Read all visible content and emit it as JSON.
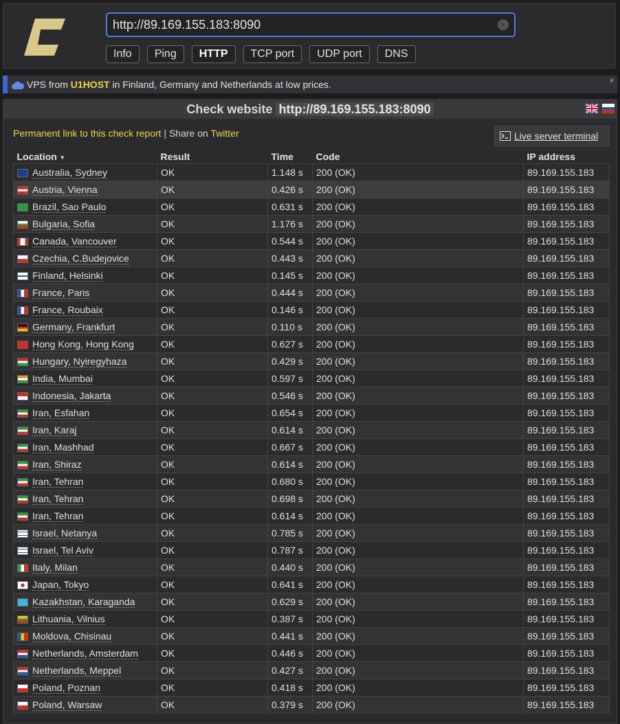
{
  "url_input": "http://89.169.155.183:8090",
  "tabs": [
    "Info",
    "Ping",
    "HTTP",
    "TCP port",
    "UDP port",
    "DNS"
  ],
  "active_tab": "HTTP",
  "banner": {
    "prefix": "VPS from ",
    "brand": "U1HOST",
    "suffix": " in Finland, Germany and Netherlands at low prices."
  },
  "panel": {
    "title_prefix": "Check website",
    "title_url": "http://89.169.155.183:8090",
    "permalink": "Permanent link to this check report",
    "share_sep": " | Share on ",
    "twitter": "Twitter",
    "terminal": "Live server terminal"
  },
  "table": {
    "headers": [
      "Location",
      "Result",
      "Time",
      "Code",
      "IP address"
    ],
    "rows": [
      {
        "flag": "au",
        "location": "Australia, Sydney",
        "result": "OK",
        "time": "1.148 s",
        "code": "200 (OK)",
        "ip": "89.169.155.183"
      },
      {
        "flag": "at",
        "location": "Austria, Vienna",
        "result": "OK",
        "time": "0.426 s",
        "code": "200 (OK)",
        "ip": "89.169.155.183"
      },
      {
        "flag": "br",
        "location": "Brazil, Sao Paulo",
        "result": "OK",
        "time": "0.631 s",
        "code": "200 (OK)",
        "ip": "89.169.155.183"
      },
      {
        "flag": "bg",
        "location": "Bulgaria, Sofia",
        "result": "OK",
        "time": "1.176 s",
        "code": "200 (OK)",
        "ip": "89.169.155.183"
      },
      {
        "flag": "ca",
        "location": "Canada, Vancouver",
        "result": "OK",
        "time": "0.544 s",
        "code": "200 (OK)",
        "ip": "89.169.155.183"
      },
      {
        "flag": "cz",
        "location": "Czechia, C.Budejovice",
        "result": "OK",
        "time": "0.443 s",
        "code": "200 (OK)",
        "ip": "89.169.155.183"
      },
      {
        "flag": "fi",
        "location": "Finland, Helsinki",
        "result": "OK",
        "time": "0.145 s",
        "code": "200 (OK)",
        "ip": "89.169.155.183"
      },
      {
        "flag": "fr",
        "location": "France, Paris",
        "result": "OK",
        "time": "0.444 s",
        "code": "200 (OK)",
        "ip": "89.169.155.183"
      },
      {
        "flag": "fr",
        "location": "France, Roubaix",
        "result": "OK",
        "time": "0.146 s",
        "code": "200 (OK)",
        "ip": "89.169.155.183"
      },
      {
        "flag": "de",
        "location": "Germany, Frankfurt",
        "result": "OK",
        "time": "0.110 s",
        "code": "200 (OK)",
        "ip": "89.169.155.183"
      },
      {
        "flag": "hk",
        "location": "Hong Kong, Hong Kong",
        "result": "OK",
        "time": "0.627 s",
        "code": "200 (OK)",
        "ip": "89.169.155.183"
      },
      {
        "flag": "hu",
        "location": "Hungary, Nyiregyhaza",
        "result": "OK",
        "time": "0.429 s",
        "code": "200 (OK)",
        "ip": "89.169.155.183"
      },
      {
        "flag": "in",
        "location": "India, Mumbai",
        "result": "OK",
        "time": "0.597 s",
        "code": "200 (OK)",
        "ip": "89.169.155.183"
      },
      {
        "flag": "id",
        "location": "Indonesia, Jakarta",
        "result": "OK",
        "time": "0.546 s",
        "code": "200 (OK)",
        "ip": "89.169.155.183"
      },
      {
        "flag": "ir",
        "location": "Iran, Esfahan",
        "result": "OK",
        "time": "0.654 s",
        "code": "200 (OK)",
        "ip": "89.169.155.183"
      },
      {
        "flag": "ir",
        "location": "Iran, Karaj",
        "result": "OK",
        "time": "0.614 s",
        "code": "200 (OK)",
        "ip": "89.169.155.183"
      },
      {
        "flag": "ir",
        "location": "Iran, Mashhad",
        "result": "OK",
        "time": "0.667 s",
        "code": "200 (OK)",
        "ip": "89.169.155.183"
      },
      {
        "flag": "ir",
        "location": "Iran, Shiraz",
        "result": "OK",
        "time": "0.614 s",
        "code": "200 (OK)",
        "ip": "89.169.155.183"
      },
      {
        "flag": "ir",
        "location": "Iran, Tehran",
        "result": "OK",
        "time": "0.680 s",
        "code": "200 (OK)",
        "ip": "89.169.155.183"
      },
      {
        "flag": "ir",
        "location": "Iran, Tehran",
        "result": "OK",
        "time": "0.698 s",
        "code": "200 (OK)",
        "ip": "89.169.155.183"
      },
      {
        "flag": "ir",
        "location": "Iran, Tehran",
        "result": "OK",
        "time": "0.614 s",
        "code": "200 (OK)",
        "ip": "89.169.155.183"
      },
      {
        "flag": "il",
        "location": "Israel, Netanya",
        "result": "OK",
        "time": "0.785 s",
        "code": "200 (OK)",
        "ip": "89.169.155.183"
      },
      {
        "flag": "il",
        "location": "Israel, Tel Aviv",
        "result": "OK",
        "time": "0.787 s",
        "code": "200 (OK)",
        "ip": "89.169.155.183"
      },
      {
        "flag": "it",
        "location": "Italy, Milan",
        "result": "OK",
        "time": "0.440 s",
        "code": "200 (OK)",
        "ip": "89.169.155.183"
      },
      {
        "flag": "jp",
        "location": "Japan, Tokyo",
        "result": "OK",
        "time": "0.641 s",
        "code": "200 (OK)",
        "ip": "89.169.155.183"
      },
      {
        "flag": "kz",
        "location": "Kazakhstan, Karaganda",
        "result": "OK",
        "time": "0.629 s",
        "code": "200 (OK)",
        "ip": "89.169.155.183"
      },
      {
        "flag": "lt",
        "location": "Lithuania, Vilnius",
        "result": "OK",
        "time": "0.387 s",
        "code": "200 (OK)",
        "ip": "89.169.155.183"
      },
      {
        "flag": "md",
        "location": "Moldova, Chisinau",
        "result": "OK",
        "time": "0.441 s",
        "code": "200 (OK)",
        "ip": "89.169.155.183"
      },
      {
        "flag": "nl",
        "location": "Netherlands, Amsterdam",
        "result": "OK",
        "time": "0.446 s",
        "code": "200 (OK)",
        "ip": "89.169.155.183"
      },
      {
        "flag": "nl",
        "location": "Netherlands, Meppel",
        "result": "OK",
        "time": "0.427 s",
        "code": "200 (OK)",
        "ip": "89.169.155.183"
      },
      {
        "flag": "pl",
        "location": "Poland, Poznan",
        "result": "OK",
        "time": "0.418 s",
        "code": "200 (OK)",
        "ip": "89.169.155.183"
      },
      {
        "flag": "pl",
        "location": "Poland, Warsaw",
        "result": "OK",
        "time": "0.379 s",
        "code": "200 (OK)",
        "ip": "89.169.155.183"
      }
    ]
  },
  "colors": {
    "accent_blue": "#4a7fd6",
    "link_yellow": "#f0d34a",
    "logo_gold": "#d9c88a"
  }
}
